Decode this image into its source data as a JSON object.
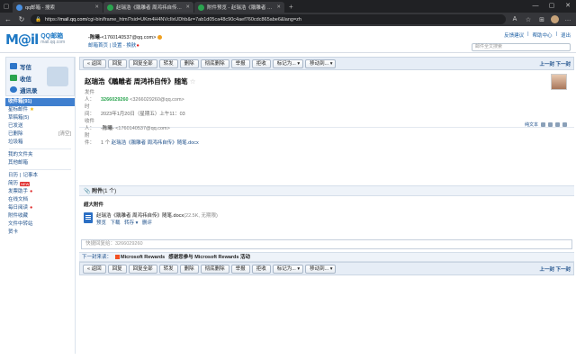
{
  "browser": {
    "tabs": [
      {
        "title": "qq邮箱 - 搜索",
        "active": false
      },
      {
        "title": "赵瑞浩《鵰雕者 周鸿祎自传》随",
        "active": true
      },
      {
        "title": "附件预览 - 赵瑞浩《鵰雕者 周鸿祎",
        "active": false
      }
    ],
    "new_tab": "+",
    "url_prefix": "https://",
    "url_domain": "mail.qq.com",
    "url_path": "/cgi-bin/frame_html?sid=UKm4H4NVcIlxUDhb&r=7ab1d05ca48c90c4aef760cdc865abe6&lang=zh"
  },
  "header": {
    "logo_mark": "M@il",
    "logo_title": "QQ邮箱",
    "logo_sub": "mail.qq.com",
    "user_name": "-陈曦-",
    "user_email": "<1760140537@qq.com>",
    "links": [
      "邮箱首页",
      "设置",
      "换肤"
    ],
    "top_links": [
      "反馈建议",
      "帮助中心",
      "退出"
    ],
    "search_placeholder": "邮件全文搜索"
  },
  "sidebar": {
    "write": "写信",
    "inbox": "收信",
    "contacts": "通讯录",
    "folders": [
      {
        "label": "收件箱(91)",
        "selected": true
      },
      {
        "label": "星标邮件",
        "star": true
      },
      {
        "label": "草稿箱(5)"
      },
      {
        "label": "已发送"
      },
      {
        "label": "已删除",
        "tag": "[清空]"
      },
      {
        "label": "垃圾箱"
      }
    ],
    "my_folders": "我的文件夹",
    "other": "其他邮箱",
    "apps1": [
      "日历",
      "记事本"
    ],
    "apps": [
      {
        "label": "简历",
        "new": "NEW"
      },
      {
        "label": "发票助手",
        "dot": true
      },
      {
        "label": "在线文档"
      },
      {
        "label": "每日阅读",
        "dot": true
      },
      {
        "label": "附件收藏"
      },
      {
        "label": "文件中转站"
      },
      {
        "label": "贺卡"
      }
    ]
  },
  "toolbar": {
    "buttons": [
      "« 返回",
      "回复",
      "回复全部",
      "转发",
      "删除",
      "彻底删除",
      "举报",
      "拒收"
    ],
    "mark": "标记为... ▾",
    "move": "移动到... ▾",
    "pager": "上一封 下一封"
  },
  "mail": {
    "subject": "赵瑞浩《鵰雕者 周鸿祎自传》随笔",
    "from_label": "发件人：",
    "from_name": "3266029260",
    "from_addr": "<3266029260@qq.com>",
    "time_label": "时　间：",
    "time": "2023年1月20日（星期五）上午11：03",
    "to_label": "收件人：",
    "to_name": "-陈曦-",
    "to_addr": "<1760140537@qq.com>",
    "att_label": "附　件：",
    "att_count": "1 个",
    "att_name": "赵瑞浩《鵰雕者 周鸿祎自传》随笔.docx",
    "plain_text": "纯文本"
  },
  "attachments": {
    "header_title": "附件",
    "header_count": "(1 个)",
    "sub": "超大附件",
    "file_name": "赵瑞浩《鵰雕者 周鸿祎自传》随笔.docx",
    "file_size": "(22.5K, 无期限)",
    "actions": [
      "预览",
      "下载",
      "转存 ▾",
      "删评"
    ]
  },
  "reply_placeholder": "快捷回复给：3266029260",
  "next_mail": {
    "label": "下一封来读：",
    "from": "Microsoft Rewards",
    "subject": "感谢您参与 Microsoft Rewards 活动"
  }
}
